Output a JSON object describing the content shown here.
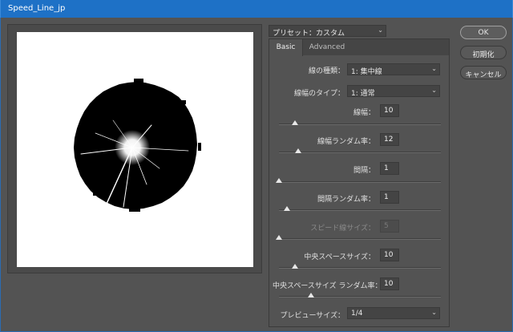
{
  "window": {
    "title": "Speed_Line_jp"
  },
  "preset": {
    "label": "プリセット：カスタム"
  },
  "tabs": [
    {
      "label": "Basic",
      "active": true
    },
    {
      "label": "Advanced",
      "active": false
    }
  ],
  "rows": {
    "line_kind": {
      "label": "線の種類：",
      "value": "1: 集中線"
    },
    "line_width_type": {
      "label": "線幅のタイプ：",
      "value": "1: 通常"
    },
    "line_width": {
      "label": "線幅：",
      "value": "10",
      "level": 0.1
    },
    "line_width_random": {
      "label": "線幅ランダム率：",
      "value": "12",
      "level": 0.12
    },
    "spacing": {
      "label": "間隔：",
      "value": "1",
      "level": 0.0
    },
    "spacing_random": {
      "label": "間隔ランダム率：",
      "value": "1",
      "level": 0.05
    },
    "speedline_size": {
      "label": "スピード線サイズ：",
      "value": "5",
      "level": 0.0,
      "disabled": true
    },
    "center_space_size": {
      "label": "中央スペースサイズ：",
      "value": "10",
      "level": 0.1
    },
    "center_space_random": {
      "label": "中央スペースサイズ ランダム率：",
      "value": "10",
      "level": 0.2
    },
    "preview_size": {
      "label": "プレビューサイズ：",
      "value": "1/4"
    }
  },
  "buttons": {
    "ok": "OK",
    "reset": "初期化",
    "cancel": "キャンセル"
  },
  "colors": {
    "titlebar": "#1e71c6",
    "panel": "#535353",
    "field": "#444444"
  }
}
